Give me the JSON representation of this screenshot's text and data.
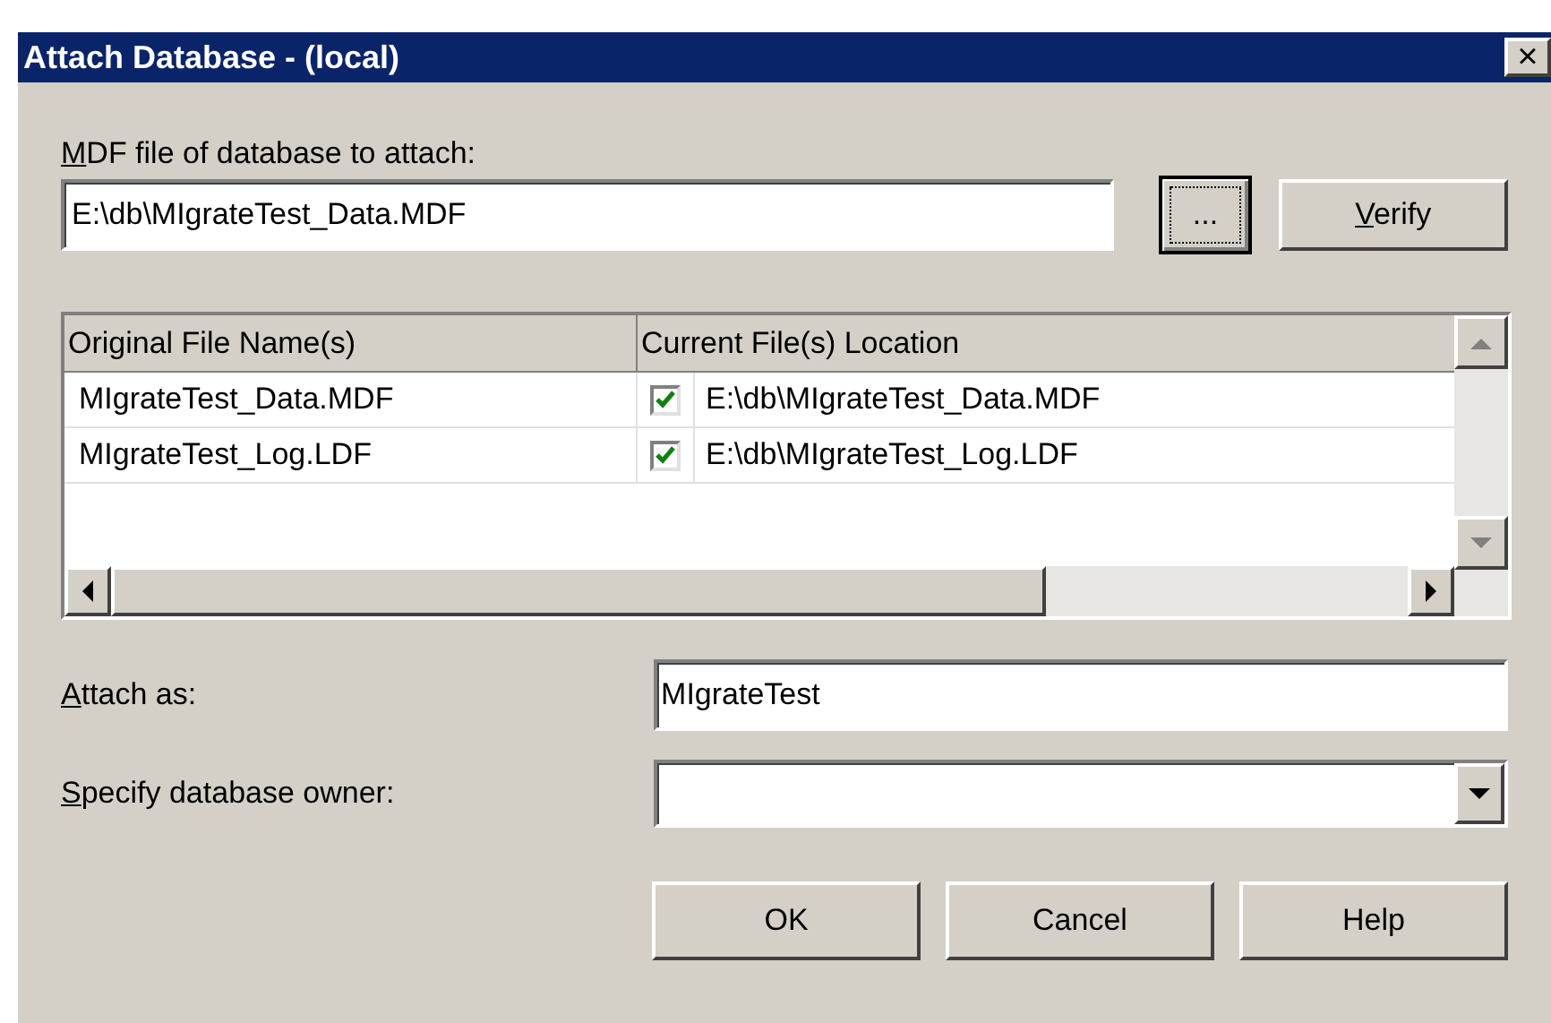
{
  "window": {
    "title": "Attach Database - (local)",
    "close": "×"
  },
  "mdf_file": {
    "label": "MDF file of database to attach:",
    "label_mnemonic": true,
    "value": "E:\\db\\MIgrateTest_Data.MDF"
  },
  "browse_button": {
    "label": "...",
    "focused": true
  },
  "verify_button": {
    "label": "Verify",
    "label_mnemonic": true
  },
  "files_table": {
    "columns": [
      "Original File Name(s)",
      "Current File(s) Location"
    ],
    "rows": [
      {
        "original": "MIgrateTest_Data.MDF",
        "checked": true,
        "location": "E:\\db\\MIgrateTest_Data.MDF"
      },
      {
        "original": "MIgrateTest_Log.LDF",
        "checked": true,
        "location": "E:\\db\\MIgrateTest_Log.LDF"
      }
    ]
  },
  "attach_as": {
    "label": "Attach as:",
    "label_mnemonic": true,
    "value": "MIgrateTest"
  },
  "owner": {
    "label": "Specify database owner:",
    "label_mnemonic": true
  },
  "buttons": [
    "OK",
    "Cancel",
    "Help"
  ]
}
